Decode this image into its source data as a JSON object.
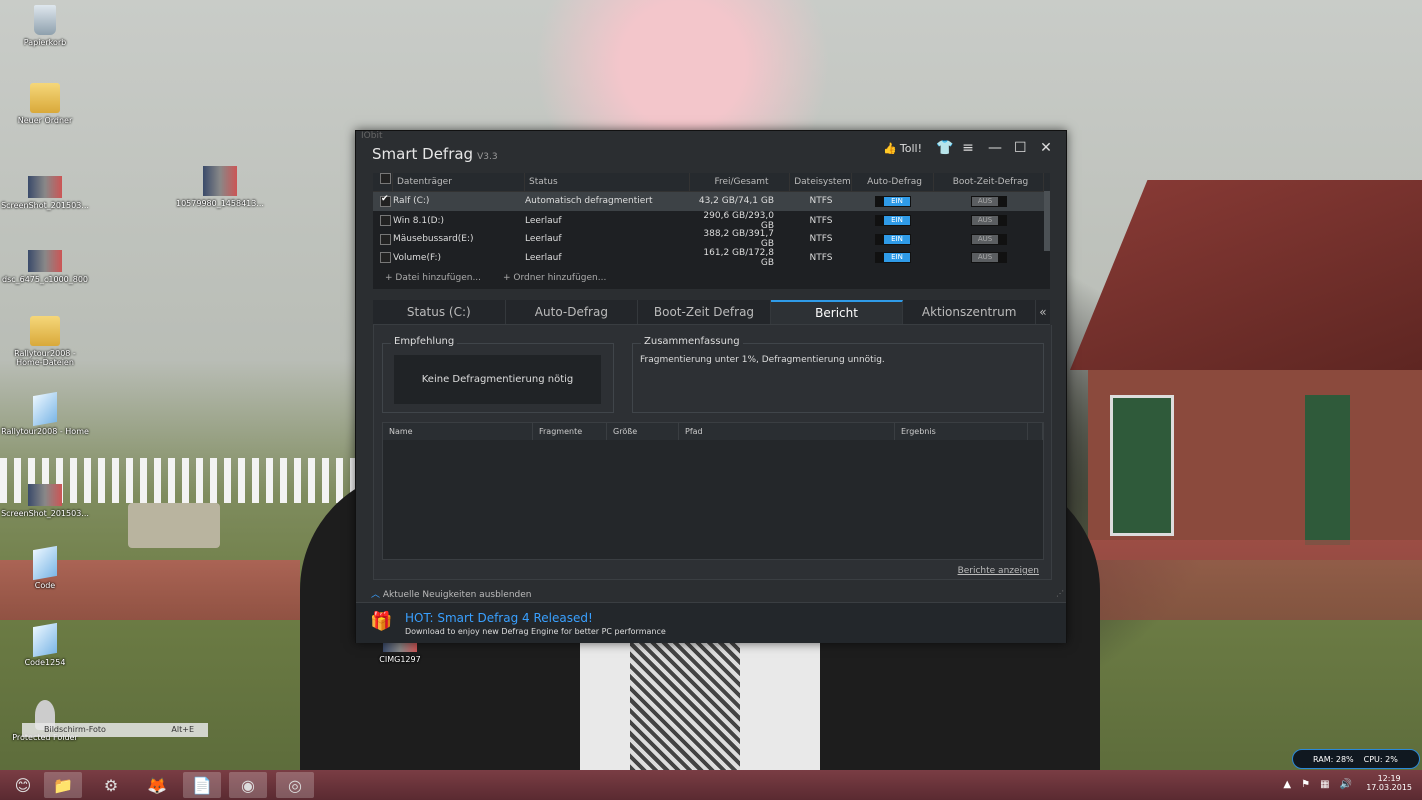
{
  "desktop": {
    "icons": [
      {
        "label": "Papierkorb",
        "icon": "recycle-bin-icon"
      },
      {
        "label": "Neuer Ordner",
        "icon": "folder-icon"
      },
      {
        "label": "ScreenShot_201503...",
        "icon": "image-thumbnail-icon"
      },
      {
        "label": "10579980_1458413...",
        "icon": "image-thumbnail-icon"
      },
      {
        "label": "dsc_6475_c1000_800",
        "icon": "image-thumbnail-icon"
      },
      {
        "label": "Rallytour2008 - Home-Dateien",
        "icon": "folder-icon"
      },
      {
        "label": "Rallytour2008 - Home",
        "icon": "html-file-icon"
      },
      {
        "label": "ScreenShot_201503...",
        "icon": "image-thumbnail-icon"
      },
      {
        "label": "Code",
        "icon": "html-file-icon"
      },
      {
        "label": "Code1254",
        "icon": "html-file-icon"
      },
      {
        "label": "Protected Folder",
        "icon": "lock-folder-icon"
      },
      {
        "label": "CIMG1297",
        "icon": "image-thumbnail-icon"
      }
    ],
    "tooltip": {
      "label": "Bildschirm-Foto",
      "shortcut": "Alt+E"
    }
  },
  "window": {
    "brand_small": "IObit",
    "title": "Smart Defrag",
    "version": "V3.3",
    "like_label": "Toll!",
    "controls": [
      "shirt-icon",
      "menu-icon",
      "minimize-icon",
      "maximize-icon",
      "close-icon"
    ]
  },
  "drives": {
    "columns": [
      "Datenträger",
      "Status",
      "Frei/Gesamt",
      "Dateisystem",
      "Auto-Defrag",
      "Boot-Zeit-Defrag"
    ],
    "rows": [
      {
        "name": "Ralf (C:)",
        "status": "Automatisch defragmentiert",
        "space": "43,2 GB/74,1 GB",
        "fs": "NTFS",
        "auto": "EIN",
        "boot": "AUS",
        "checked": true
      },
      {
        "name": "Win 8.1(D:)",
        "status": "Leerlauf",
        "space": "290,6 GB/293,0 GB",
        "fs": "NTFS",
        "auto": "EIN",
        "boot": "AUS",
        "checked": false
      },
      {
        "name": "Mäusebussard(E:)",
        "status": "Leerlauf",
        "space": "388,2 GB/391,7 GB",
        "fs": "NTFS",
        "auto": "EIN",
        "boot": "AUS",
        "checked": false
      },
      {
        "name": "Volume(F:)",
        "status": "Leerlauf",
        "space": "161,2 GB/172,8 GB",
        "fs": "NTFS",
        "auto": "EIN",
        "boot": "AUS",
        "checked": false
      }
    ],
    "add_file": "+ Datei hinzufügen...",
    "add_folder": "+ Ordner hinzufügen..."
  },
  "tabs": [
    "Status (C:)",
    "Auto-Defrag",
    "Boot-Zeit Defrag",
    "Bericht",
    "Aktionszentrum"
  ],
  "active_tab": "Bericht",
  "collapse_glyph": "«",
  "report": {
    "recommendation_title": "Empfehlung",
    "recommendation_text": "Keine Defragmentierung nötig",
    "summary_title": "Zusammenfassung",
    "summary_text": "Fragmentierung unter 1%, Defragmentierung unnötig.",
    "columns": [
      "Name",
      "Fragmente",
      "Größe",
      "Pfad",
      "Ergebnis"
    ],
    "show_reports": "Berichte anzeigen"
  },
  "news": {
    "toggle": "Aktuelle Neuigkeiten ausblenden",
    "title": "HOT: Smart Defrag 4 Released!",
    "subtitle": "Download to enjoy new Defrag Engine for better PC performance"
  },
  "gadget": {
    "ram": "RAM: 28%",
    "cpu": "CPU: 2%"
  },
  "taskbar": {
    "items": [
      "smiley-icon",
      "file-explorer-icon",
      "media-app-icon",
      "firefox-icon",
      "text-editor-icon",
      "nvu-icon",
      "smart-defrag-icon"
    ],
    "time": "12:19",
    "date": "17.03.2015"
  },
  "colors": {
    "accent": "#2f9be8",
    "window_bg": "#2b2e31",
    "taskbar": "#6b333a"
  }
}
